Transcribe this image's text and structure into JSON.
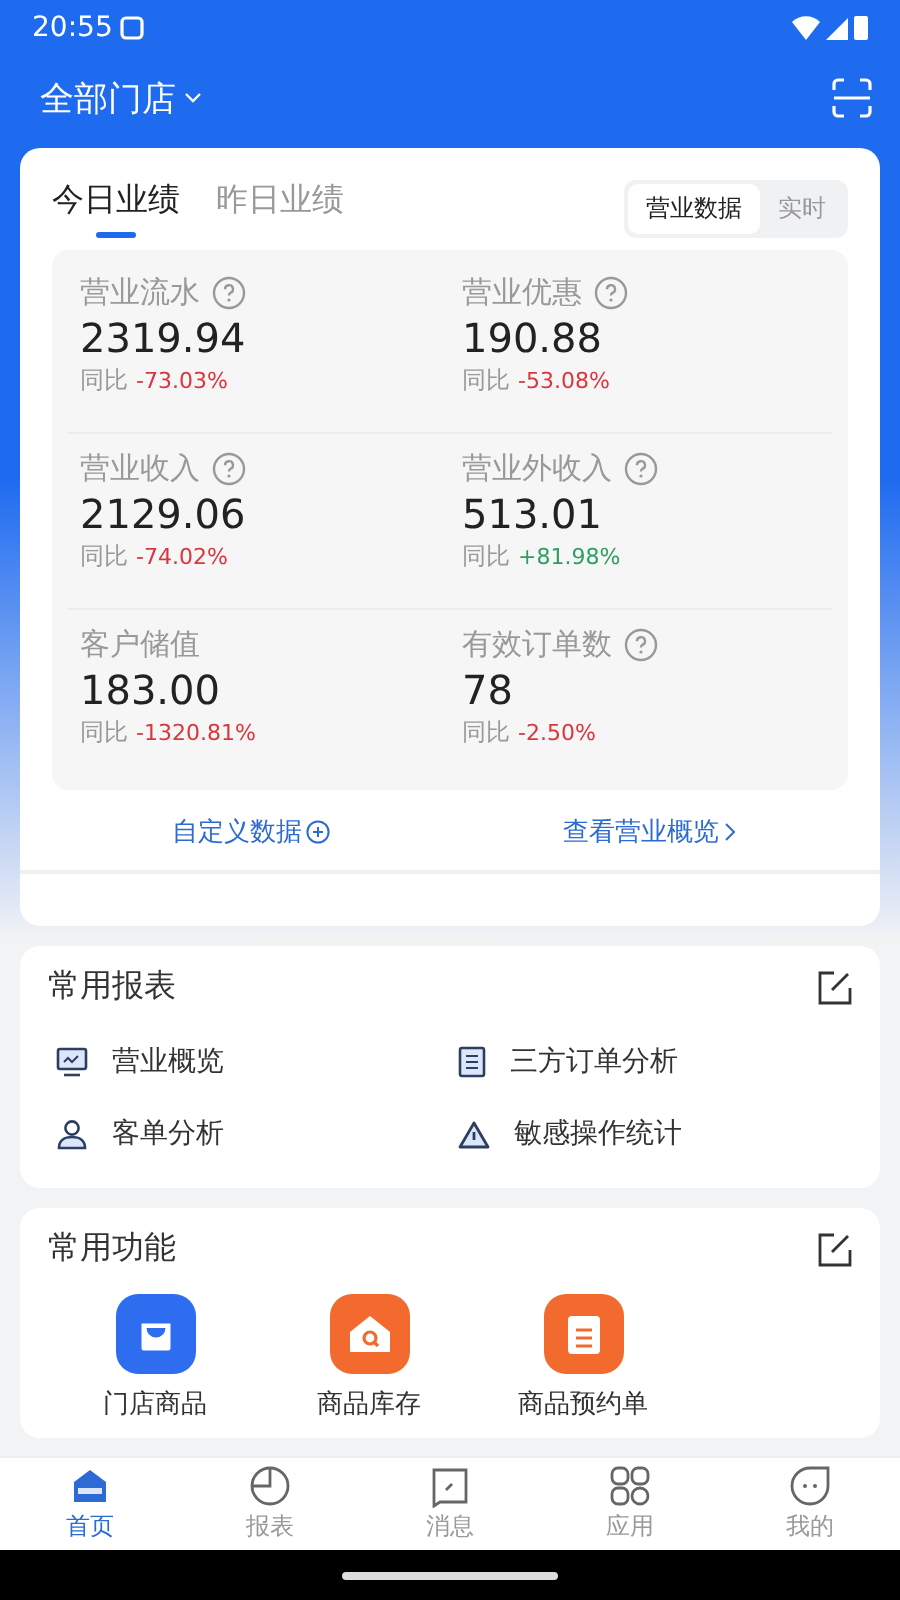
{
  "status_bar": {
    "time": "20:55"
  },
  "header": {
    "store_selector": "全部门店"
  },
  "performance": {
    "tabs": [
      {
        "label": "今日业绩",
        "selected": true
      },
      {
        "label": "昨日业绩",
        "selected": false
      }
    ],
    "segments": [
      {
        "label": "营业数据",
        "selected": true
      },
      {
        "label": "实时",
        "selected": false
      }
    ],
    "metrics": [
      {
        "label": "营业流水",
        "help": true,
        "value": "2319.94",
        "compare_label": "同比",
        "change": "-73.03%",
        "color": "#d9363e"
      },
      {
        "label": "营业优惠",
        "help": true,
        "value": "190.88",
        "compare_label": "同比",
        "change": "-53.08%",
        "color": "#d9363e"
      },
      {
        "label": "营业收入",
        "help": true,
        "value": "2129.06",
        "compare_label": "同比",
        "change": "-74.02%",
        "color": "#d9363e"
      },
      {
        "label": "营业外收入",
        "help": true,
        "value": "513.01",
        "compare_label": "同比",
        "change": "+81.98%",
        "color": "#2e9e62"
      },
      {
        "label": "客户储值",
        "help": false,
        "value": "183.00",
        "compare_label": "同比",
        "change": "-1320.81%",
        "color": "#d9363e"
      },
      {
        "label": "有效订单数",
        "help": true,
        "value": "78",
        "compare_label": "同比",
        "change": "-2.50%",
        "color": "#d9363e"
      }
    ],
    "links": [
      {
        "label": "自定义数据",
        "kind": "add"
      },
      {
        "label": "查看营业概览",
        "kind": "more"
      }
    ]
  },
  "reports": {
    "title": "常用报表",
    "items": [
      {
        "label": "营业概览",
        "kind": "monitor"
      },
      {
        "label": "三方订单分析",
        "kind": "document"
      },
      {
        "label": "客单分析",
        "kind": "person"
      },
      {
        "label": "敏感操作统计",
        "kind": "warning"
      }
    ]
  },
  "functions": {
    "title": "常用功能",
    "items": [
      {
        "label": "门店商品",
        "kind": "bag",
        "color": "#2f6df0"
      },
      {
        "label": "商品库存",
        "kind": "house",
        "color": "#f26a2e"
      },
      {
        "label": "商品预约单",
        "kind": "clipboard",
        "color": "#f26a2e"
      }
    ]
  },
  "tab_bar": [
    {
      "label": "首页",
      "kind": "home",
      "selected": true
    },
    {
      "label": "报表",
      "kind": "chart",
      "selected": false
    },
    {
      "label": "消息",
      "kind": "message",
      "selected": false
    },
    {
      "label": "应用",
      "kind": "apps",
      "selected": false
    },
    {
      "label": "我的",
      "kind": "me",
      "selected": false
    }
  ]
}
